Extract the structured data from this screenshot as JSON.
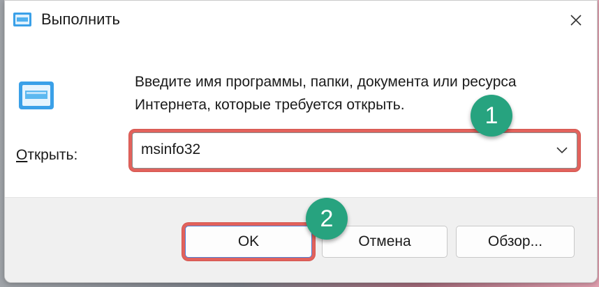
{
  "window": {
    "title": "Выполнить",
    "close_icon": "close-icon"
  },
  "content": {
    "description": "Введите имя программы, папки, документа или ресурса Интернета, которые требуется открыть.",
    "open_label_underlined": "О",
    "open_label_rest": "ткрыть:",
    "combo_value": "msinfo32"
  },
  "buttons": {
    "ok": "OK",
    "cancel": "Отмена",
    "browse": "Обзор..."
  },
  "annotations": {
    "badge_1": "1",
    "badge_2": "2",
    "highlight_color": "#e2625c",
    "badge_color": "#27a37f"
  }
}
